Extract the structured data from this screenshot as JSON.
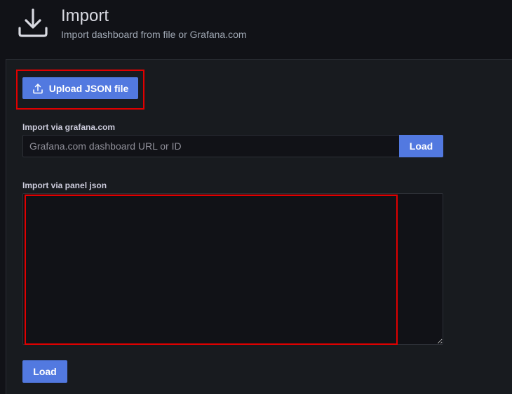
{
  "header": {
    "icon": "download-icon",
    "title": "Import",
    "subtitle": "Import dashboard from file or Grafana.com"
  },
  "upload": {
    "icon": "upload-icon",
    "label": "Upload JSON file"
  },
  "grafana_com": {
    "label": "Import via grafana.com",
    "value": "",
    "placeholder": "Grafana.com dashboard URL or ID",
    "load_label": "Load"
  },
  "panel_json": {
    "label": "Import via panel json",
    "value": ""
  },
  "footer": {
    "load_label": "Load"
  },
  "colors": {
    "primary_button": "#5279e0",
    "background": "#111217",
    "panel": "#181b1f",
    "highlight": "#e00000"
  }
}
